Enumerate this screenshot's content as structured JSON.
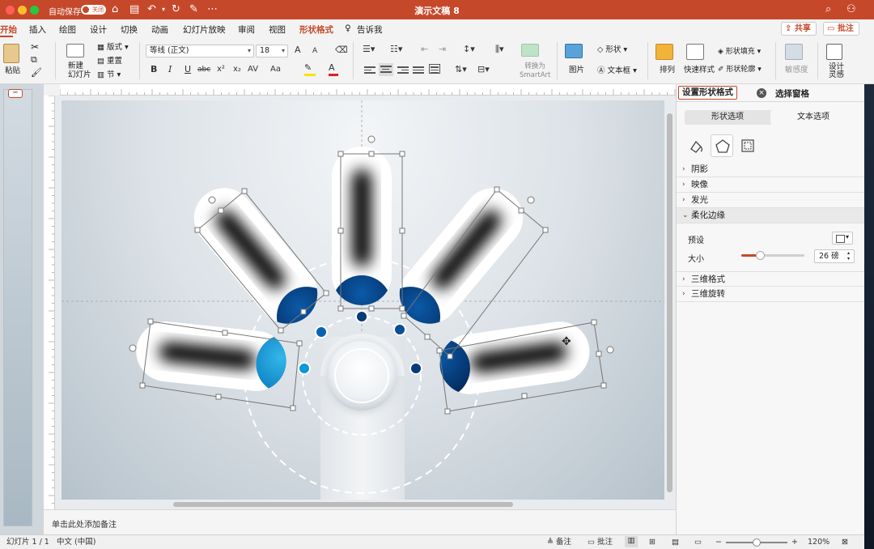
{
  "window": {
    "title": "演示文稿 8",
    "autosave_label": "自动保存",
    "autosave_state": "关闭"
  },
  "titlebar_icons": [
    "home-icon",
    "save-icon",
    "undo-icon",
    "redo-icon",
    "edit-doc-icon",
    "more-icon",
    "search-icon",
    "account-icon"
  ],
  "menu": {
    "tabs": [
      "开始",
      "插入",
      "绘图",
      "设计",
      "切换",
      "动画",
      "幻灯片放映",
      "审阅",
      "视图",
      "形状格式"
    ],
    "active_tab": "开始",
    "tell_me": "告诉我",
    "share": "共享",
    "comments": "批注"
  },
  "ribbon": {
    "paste": "粘贴",
    "new_slide": "新建\n幻灯片",
    "layout": "版式",
    "reset": "重置",
    "section": "节",
    "font_name": "等线 (正文)",
    "font_size": "18",
    "bold": "B",
    "italic": "I",
    "underline": "U",
    "strike": "abc",
    "superscript": "x²",
    "subscript": "x₂",
    "char_spacing": "AV",
    "change_case": "Aa",
    "grow_font": "A",
    "shrink_font": "A",
    "convert_smartart": "转换为\nSmartArt",
    "picture": "图片",
    "shapes": "形状",
    "textbox": "文本框",
    "arrange": "排列",
    "quick_styles": "快速样式",
    "shape_fill": "形状填充",
    "shape_outline": "形状轮廓",
    "sensitivity": "敏感度",
    "designer": "设计\n灵感",
    "highlight_color": "#f5e400",
    "font_color": "#e02020"
  },
  "editor": {
    "notes_placeholder": "单击此处添加备注"
  },
  "format_panel": {
    "title": "设置形状格式",
    "tab2": "选择窗格",
    "subtabs": [
      "形状选项",
      "文本选项"
    ],
    "active_subtab": "形状选项",
    "icons": [
      "fill-line-icon",
      "effects-icon",
      "size-properties-icon"
    ],
    "sections": [
      {
        "label": "阴影",
        "open": false
      },
      {
        "label": "映像",
        "open": false
      },
      {
        "label": "发光",
        "open": false
      },
      {
        "label": "柔化边缘",
        "open": true
      },
      {
        "label": "三维格式",
        "open": false
      },
      {
        "label": "三维旋转",
        "open": false
      }
    ],
    "preset_label": "预设",
    "size_label": "大小",
    "size_value": "26 磅",
    "size_fraction": 0.3
  },
  "status": {
    "slide_count": "幻灯片 1 / 1",
    "language": "中文 (中国)",
    "notes": "备注",
    "comments": "批注",
    "zoom": "120%",
    "zoom_fraction": 0.5
  },
  "colors": {
    "accent": "#c6482b",
    "dark_blue": "#063a78",
    "mid_blue": "#0a63b0",
    "bright_blue": "#0a98d6"
  }
}
